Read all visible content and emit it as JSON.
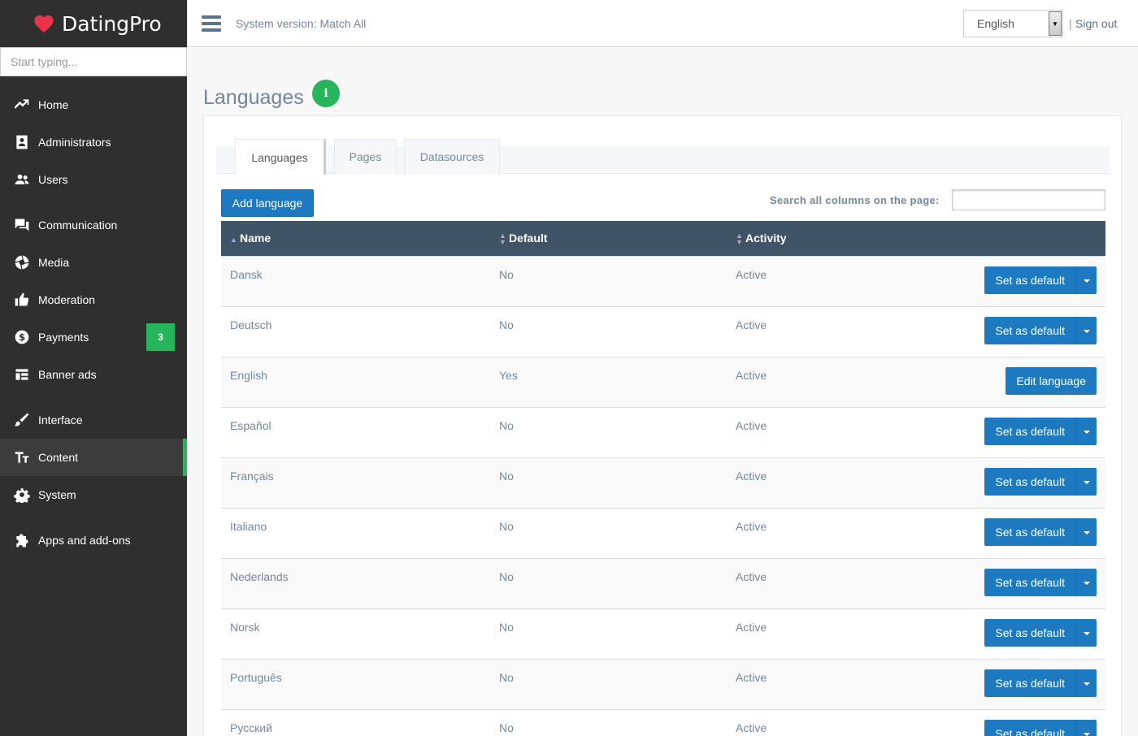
{
  "brand": {
    "name": "DatingPro"
  },
  "sidebar": {
    "search_placeholder": "Start typing...",
    "items": [
      {
        "label": "Home",
        "icon": "trend-icon"
      },
      {
        "label": "Administrators",
        "icon": "admin-icon"
      },
      {
        "label": "Users",
        "icon": "users-icon"
      },
      {
        "label": "Communication",
        "icon": "chat-icon"
      },
      {
        "label": "Media",
        "icon": "aperture-icon"
      },
      {
        "label": "Moderation",
        "icon": "thumbs-up-icon"
      },
      {
        "label": "Payments",
        "icon": "dollar-icon",
        "badge": "3"
      },
      {
        "label": "Banner ads",
        "icon": "layout-icon"
      },
      {
        "label": "Interface",
        "icon": "brush-icon"
      },
      {
        "label": "Content",
        "icon": "text-size-icon",
        "active": true
      },
      {
        "label": "System",
        "icon": "gear-icon"
      },
      {
        "label": "Apps and add-ons",
        "icon": "puzzle-icon"
      }
    ]
  },
  "topbar": {
    "system_version": "System version: Match All",
    "language": "English",
    "separator": "|",
    "signout": "Sign out"
  },
  "page": {
    "title": "Languages",
    "info_icon": "i"
  },
  "tabs": [
    "Languages",
    "Pages",
    "Datasources"
  ],
  "toolbar": {
    "add_label": "Add language",
    "search_label": "Search all columns on the page:"
  },
  "table": {
    "headers": [
      "Name",
      "Default",
      "Activity"
    ],
    "rows": [
      {
        "name": "Dansk",
        "default": "No",
        "activity": "Active",
        "action": "Set as default"
      },
      {
        "name": "Deutsch",
        "default": "No",
        "activity": "Active",
        "action": "Set as default"
      },
      {
        "name": "English",
        "default": "Yes",
        "activity": "Active",
        "action": "Edit language"
      },
      {
        "name": "Español",
        "default": "No",
        "activity": "Active",
        "action": "Set as default"
      },
      {
        "name": "Français",
        "default": "No",
        "activity": "Active",
        "action": "Set as default"
      },
      {
        "name": "Italiano",
        "default": "No",
        "activity": "Active",
        "action": "Set as default"
      },
      {
        "name": "Nederlands",
        "default": "No",
        "activity": "Active",
        "action": "Set as default"
      },
      {
        "name": "Norsk",
        "default": "No",
        "activity": "Active",
        "action": "Set as default"
      },
      {
        "name": "Português",
        "default": "No",
        "activity": "Active",
        "action": "Set as default"
      },
      {
        "name": "Русский",
        "default": "No",
        "activity": "Active",
        "action": "Set as default"
      }
    ]
  },
  "colors": {
    "sidebar_bg": "#2f2f2f",
    "accent_green": "#26b55a",
    "button_blue": "#1d7ac0",
    "header_bg": "#405467"
  }
}
